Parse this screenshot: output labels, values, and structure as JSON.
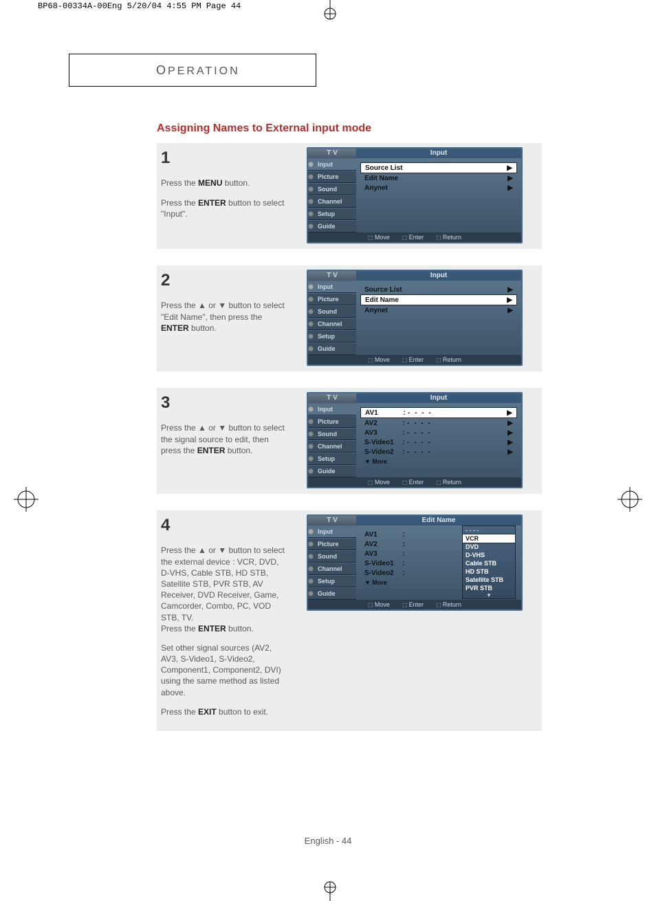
{
  "print_header": "BP68-00334A-00Eng  5/20/04  4:55 PM  Page 44",
  "chapter": "OPERATION",
  "section_title": "Assigning Names to External input mode",
  "page_footer": "English - 44",
  "osd_side_items": [
    "Input",
    "Picture",
    "Sound",
    "Channel",
    "Setup",
    "Guide"
  ],
  "osd_top_tv": "T V",
  "osd_footer": {
    "move": "Move",
    "enter": "Enter",
    "return": "Return"
  },
  "steps": [
    {
      "num": "1",
      "text_a": "Press the ",
      "bold_a": "MENU",
      "text_b": " button.",
      "text_c": "Press the ",
      "bold_c": "ENTER",
      "text_d": " button to select \"Input\".",
      "osd_title": "Input",
      "rows": [
        {
          "label": "Source List",
          "arrow": "▶",
          "sel": true
        },
        {
          "label": "Edit Name",
          "arrow": "▶"
        },
        {
          "label": "Anynet",
          "arrow": "▶"
        }
      ]
    },
    {
      "num": "2",
      "text_a": "Press the ▲ or ▼ button to select \"Edit Name\", then press the ",
      "bold_a": "ENTER",
      "text_b": " button.",
      "osd_title": "Input",
      "rows": [
        {
          "label": "Source List",
          "arrow": "▶"
        },
        {
          "label": "Edit Name",
          "arrow": "▶",
          "sel": true
        },
        {
          "label": "Anynet",
          "arrow": "▶"
        }
      ]
    },
    {
      "num": "3",
      "text_a": "Press the ▲ or ▼ button to select the signal source to edit, then press the ",
      "bold_a": "ENTER",
      "text_b": " button.",
      "osd_title": "Input",
      "rows": [
        {
          "label": "AV1",
          "value": "- - - -",
          "arrow": "▶",
          "sel": true
        },
        {
          "label": "AV2",
          "value": "- - - -",
          "arrow": "▶"
        },
        {
          "label": "AV3",
          "value": "- - - -",
          "arrow": "▶"
        },
        {
          "label": "S-Video1",
          "value": "- - - -",
          "arrow": "▶"
        },
        {
          "label": "S-Video2",
          "value": "- - - -",
          "arrow": "▶"
        }
      ],
      "more": "▼ More"
    },
    {
      "num": "4",
      "text_a": "Press the ▲ or ▼ button to select the external device : VCR, DVD, D-VHS, Cable STB, HD STB, Satellite STB, PVR STB, AV Receiver, DVD Receiver, Game, Camcorder, Combo, PC, VOD STB, TV.",
      "text_b": "Press the ",
      "bold_b": "ENTER",
      "text_c": " button.",
      "text_d": "Set other signal sources (AV2,  AV3, S-Video1, S-Video2, Component1, Component2, DVI) using the same method as listed above.",
      "text_e": "Press the ",
      "bold_e": "EXIT",
      "text_f": " button to exit.",
      "osd_title": "Edit Name",
      "rows": [
        {
          "label": "AV1",
          "value": "",
          "sel": false,
          "colon": ":"
        },
        {
          "label": "AV2",
          "value": "",
          "colon": ":"
        },
        {
          "label": "AV3",
          "value": "",
          "colon": ":"
        },
        {
          "label": "S-Video1",
          "value": "",
          "colon": ":"
        },
        {
          "label": "S-Video2",
          "value": "",
          "colon": ":"
        }
      ],
      "more": "▼ More",
      "popup_dots": "- - - -",
      "popup": [
        "VCR",
        "DVD",
        "D-VHS",
        "Cable STB",
        "HD STB",
        "Satellite STB",
        "PVR STB"
      ]
    }
  ]
}
